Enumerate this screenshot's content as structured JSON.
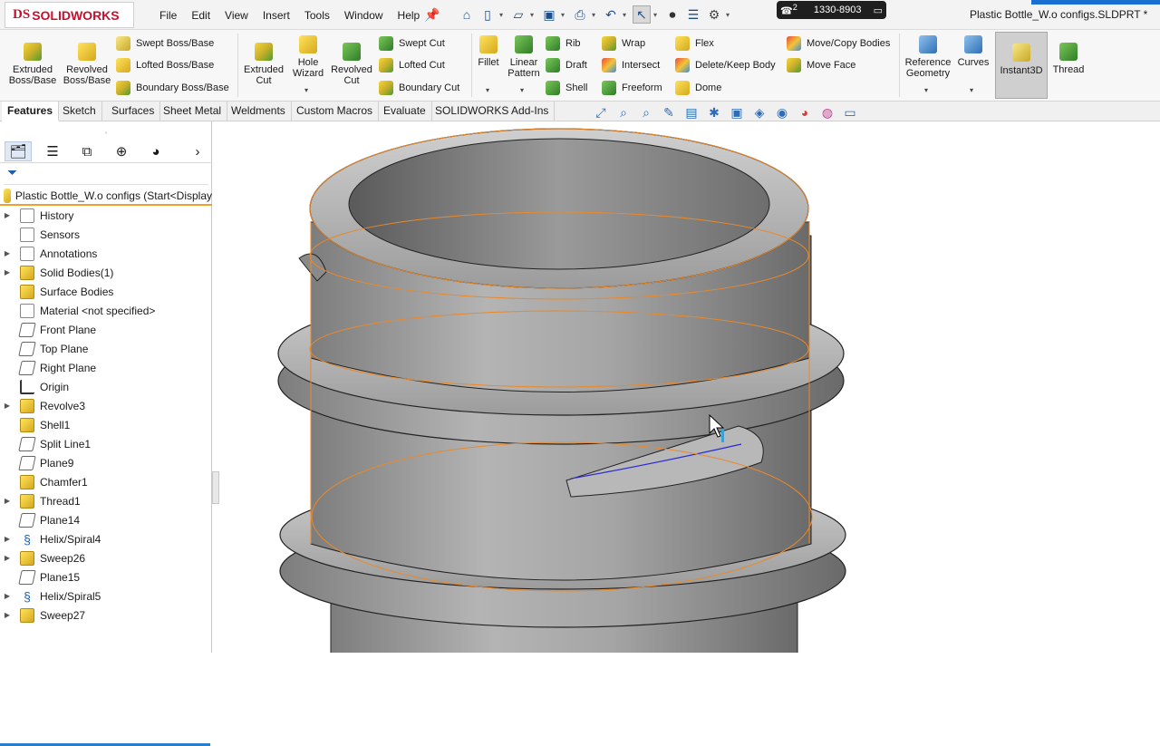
{
  "app": {
    "logo_text": "SOLIDWORKS",
    "logo_mark": "DS"
  },
  "menu": [
    "File",
    "Edit",
    "View",
    "Insert",
    "Tools",
    "Window",
    "Help"
  ],
  "phone": {
    "icon": "☎",
    "superscript": "2",
    "number": "1330-8903"
  },
  "document_title": "Plastic Bottle_W.o configs.SLDPRT *",
  "ribbon": {
    "extruded_boss": "Extruded Boss/Base",
    "revolved_boss": "Revolved Boss/Base",
    "swept_boss": "Swept Boss/Base",
    "lofted_boss": "Lofted Boss/Base",
    "boundary_boss": "Boundary Boss/Base",
    "extruded_cut": "Extruded Cut",
    "hole_wizard": "Hole Wizard",
    "revolved_cut": "Revolved Cut",
    "swept_cut": "Swept Cut",
    "lofted_cut": "Lofted Cut",
    "boundary_cut": "Boundary Cut",
    "fillet": "Fillet",
    "linear_pattern": "Linear Pattern",
    "rib": "Rib",
    "draft": "Draft",
    "shell": "Shell",
    "wrap": "Wrap",
    "intersect": "Intersect",
    "freeform": "Freeform",
    "flex": "Flex",
    "delete_keep_body": "Delete/Keep Body",
    "dome": "Dome",
    "move_copy_bodies": "Move/Copy Bodies",
    "move_face": "Move Face",
    "reference_geometry": "Reference Geometry",
    "curves": "Curves",
    "instant3d": "Instant3D",
    "thread": "Thread"
  },
  "tabs": [
    "Features",
    "Sketch",
    "Surfaces",
    "Sheet Metal",
    "Weldments",
    "Custom Macros",
    "Evaluate",
    "SOLIDWORKS Add-Ins"
  ],
  "feature_manager": {
    "root": "Plastic Bottle_W.o configs  (Start<Display",
    "items": [
      {
        "label": "History",
        "expandable": true,
        "icon": "history-icon"
      },
      {
        "label": "Sensors",
        "expandable": false,
        "icon": "sensors-icon"
      },
      {
        "label": "Annotations",
        "expandable": true,
        "icon": "annotations-icon"
      },
      {
        "label": "Solid Bodies(1)",
        "expandable": true,
        "icon": "solid-bodies-icon"
      },
      {
        "label": "Surface Bodies",
        "expandable": false,
        "icon": "surface-bodies-icon"
      },
      {
        "label": "Material <not specified>",
        "expandable": false,
        "icon": "material-icon"
      },
      {
        "label": "Front Plane",
        "expandable": false,
        "icon": "plane-icon"
      },
      {
        "label": "Top Plane",
        "expandable": false,
        "icon": "plane-icon"
      },
      {
        "label": "Right Plane",
        "expandable": false,
        "icon": "plane-icon"
      },
      {
        "label": "Origin",
        "expandable": false,
        "icon": "origin-icon"
      },
      {
        "label": "Revolve3",
        "expandable": true,
        "icon": "revolve-icon"
      },
      {
        "label": "Shell1",
        "expandable": false,
        "icon": "shell-icon"
      },
      {
        "label": "Split Line1",
        "expandable": false,
        "icon": "split-line-icon"
      },
      {
        "label": "Plane9",
        "expandable": false,
        "icon": "plane-icon"
      },
      {
        "label": "Chamfer1",
        "expandable": false,
        "icon": "chamfer-icon"
      },
      {
        "label": "Thread1",
        "expandable": true,
        "icon": "thread-icon"
      },
      {
        "label": "Plane14",
        "expandable": false,
        "icon": "plane-icon"
      },
      {
        "label": "Helix/Spiral4",
        "expandable": true,
        "icon": "helix-icon"
      },
      {
        "label": "Sweep26",
        "expandable": true,
        "icon": "sweep-icon"
      },
      {
        "label": "Plane15",
        "expandable": false,
        "icon": "plane-icon"
      },
      {
        "label": "Helix/Spiral5",
        "expandable": true,
        "icon": "helix-icon"
      },
      {
        "label": "Sweep27",
        "expandable": true,
        "icon": "sweep-icon"
      }
    ]
  },
  "colors": {
    "accent": "#2b7bd1",
    "selection_edge": "#e8892b",
    "model_gray": "#9a9a9a",
    "logo_red": "#c8102e"
  }
}
